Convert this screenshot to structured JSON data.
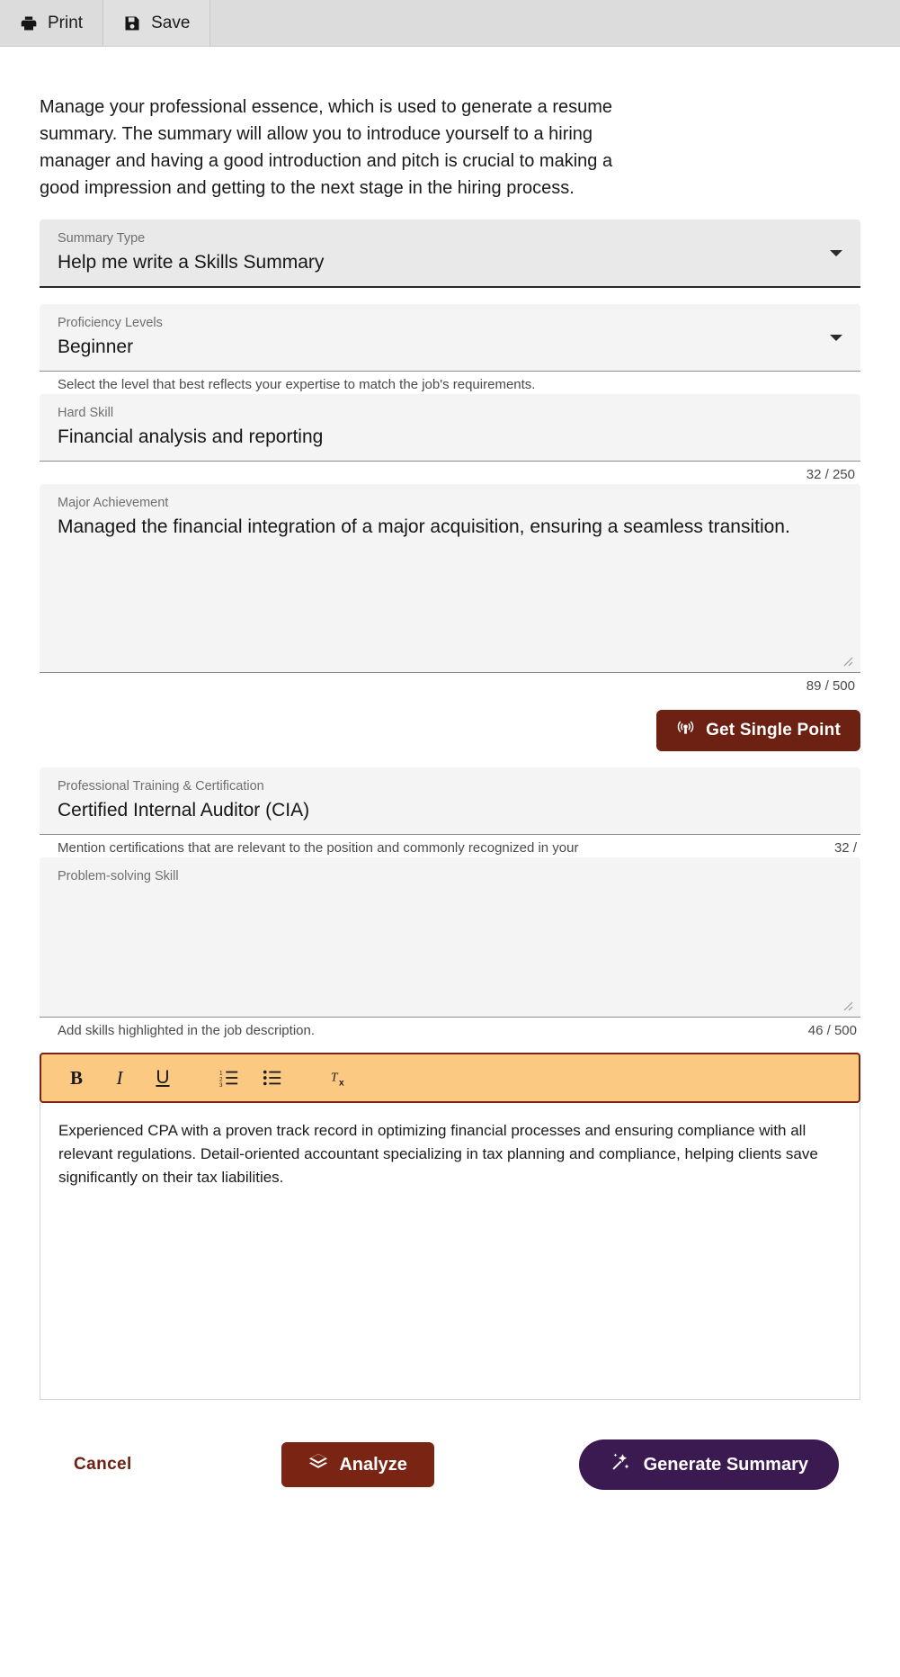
{
  "toolbar": {
    "print_label": "Print",
    "save_label": "Save",
    "print_icon": "printer-icon",
    "save_icon": "floppy-disk-icon"
  },
  "intro": {
    "text": "Manage your professional essence, which is used to generate a resume summary. The summary will allow you to introduce yourself to a hiring manager and having a good introduction and pitch is crucial to making a good impression and getting to the next stage in the hiring process."
  },
  "fields": {
    "summary_type": {
      "label": "Summary Type",
      "value": "Help me write a Skills Summary",
      "icon": "chevron-down-icon"
    },
    "proficiency": {
      "label": "Proficiency Levels",
      "value": "Beginner",
      "icon": "chevron-down-icon",
      "helper": "Select the level that best reflects your expertise to match the job's requirements."
    },
    "hard_skill": {
      "label": "Hard Skill",
      "value": "Financial analysis and reporting",
      "counter": "32 / 250"
    },
    "major_achievement": {
      "label": "Major Achievement",
      "value": "Managed the financial integration of a major acquisition, ensuring a seamless transition.",
      "counter": "89 / 500"
    },
    "professional_training": {
      "label": "Professional Training & Certification",
      "value": "Certified Internal Auditor (CIA)",
      "helper": "Mention certifications that are relevant to the position and commonly recognized in your",
      "counter": "32 /"
    },
    "problem_solving": {
      "label": "Problem-solving Skill",
      "value": "",
      "helper": "Add skills highlighted in the job description.",
      "counter": "46 / 500"
    }
  },
  "single_point": {
    "label": "Get Single Point",
    "icon": "broadcast-icon",
    "color": "#6d2112"
  },
  "editor": {
    "toolbar_bg": "#fbc981",
    "toolbar_border": "#7a2413",
    "buttons": [
      {
        "name": "bold-icon",
        "glyph": "B",
        "title": "Bold"
      },
      {
        "name": "italic-icon",
        "glyph": "I",
        "title": "Italic"
      },
      {
        "name": "underline-icon",
        "glyph": "U",
        "title": "Underline"
      },
      {
        "name": "numbered-list-icon",
        "glyph": "",
        "title": "Numbered list"
      },
      {
        "name": "bulleted-list-icon",
        "glyph": "",
        "title": "Bulleted list"
      },
      {
        "name": "clear-format-icon",
        "glyph": "",
        "title": "Remove format"
      }
    ],
    "content": "Experienced CPA with a proven track record in optimizing financial processes and ensuring compliance with all relevant regulations. Detail-oriented accountant specializing in tax planning and compliance, helping clients save significantly on their tax liabilities."
  },
  "actions": {
    "cancel_label": "Cancel",
    "analyze_label": "Analyze",
    "analyze_icon": "layers-icon",
    "generate_label": "Generate Summary",
    "generate_icon": "magic-wand-icon",
    "analyze_color": "#7a2413",
    "generate_color": "#3b1a52",
    "cancel_color": "#6d2112"
  }
}
